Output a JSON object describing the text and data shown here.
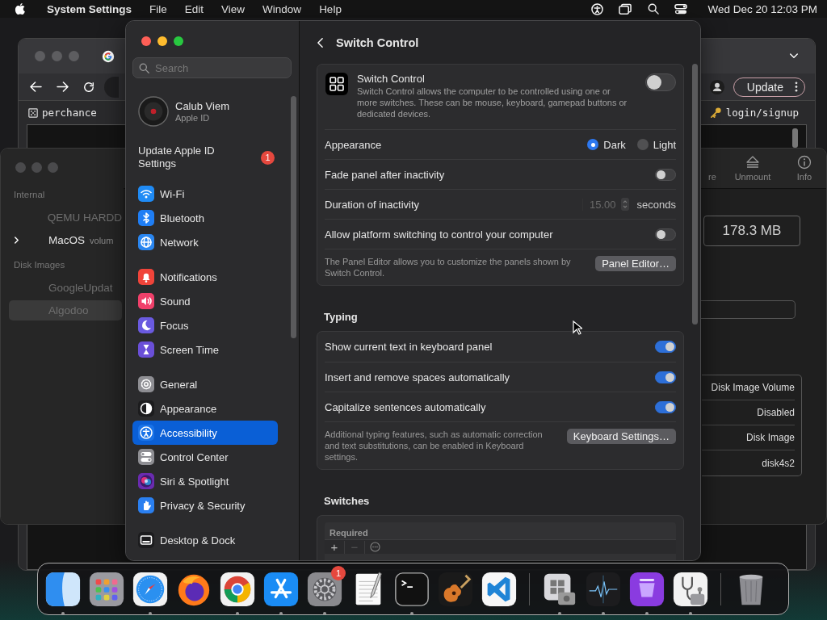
{
  "menu_bar": {
    "app_name": "System Settings",
    "menus": [
      "File",
      "Edit",
      "View",
      "Window",
      "Help"
    ],
    "clock": "Wed Dec 20  12:03 PM"
  },
  "browser": {
    "bookmark": "perchance",
    "update_button": "Update",
    "account_link": "login/signup"
  },
  "disk_utility": {
    "sidebar": [
      {
        "title": "Internal",
        "items": [
          {
            "label": "QEMU HARDD",
            "has_children": false,
            "dimmed": true,
            "selected": false
          },
          {
            "label": "MacOS",
            "detail": "volum",
            "has_children": true,
            "dimmed": false,
            "selected": false
          }
        ]
      },
      {
        "title": "Disk Images",
        "items": [
          {
            "label": "GoogleUpdat",
            "has_children": false,
            "dimmed": true,
            "selected": false
          },
          {
            "label": "Algodoo",
            "has_children": false,
            "dimmed": true,
            "selected": true
          }
        ]
      }
    ],
    "toolbar": [
      {
        "label": "re",
        "kind": "cut"
      },
      {
        "label": "Unmount",
        "kind": "eject"
      },
      {
        "label": "Info",
        "kind": "info"
      }
    ],
    "size": "178.3 MB",
    "info_values": [
      "Disk Image Volume",
      "Disabled",
      "Disk Image",
      "disk4s2"
    ]
  },
  "settings": {
    "search_placeholder": "Search",
    "account": {
      "name": "Calub Viem",
      "subtitle": "Apple ID"
    },
    "notice": {
      "label": "Update Apple ID Settings",
      "badge": "1"
    },
    "sidebar_groups": [
      [
        {
          "label": "Wi-Fi",
          "kind": "wifi",
          "selected": false
        },
        {
          "label": "Bluetooth",
          "kind": "bluetooth",
          "selected": false
        },
        {
          "label": "Network",
          "kind": "network",
          "selected": false
        }
      ],
      [
        {
          "label": "Notifications",
          "kind": "bell",
          "selected": false
        },
        {
          "label": "Sound",
          "kind": "sound",
          "selected": false
        },
        {
          "label": "Focus",
          "kind": "moon",
          "selected": false
        },
        {
          "label": "Screen Time",
          "kind": "hourglass",
          "selected": false
        }
      ],
      [
        {
          "label": "General",
          "kind": "gear",
          "selected": false
        },
        {
          "label": "Appearance",
          "kind": "appearance",
          "selected": false
        },
        {
          "label": "Accessibility",
          "kind": "accessibility",
          "selected": true
        },
        {
          "label": "Control Center",
          "kind": "toggles",
          "selected": false
        },
        {
          "label": "Siri & Spotlight",
          "kind": "orb",
          "selected": false
        },
        {
          "label": "Privacy & Security",
          "kind": "hand",
          "selected": false
        }
      ],
      [
        {
          "label": "Desktop & Dock",
          "kind": "desktop",
          "selected": false
        }
      ]
    ],
    "page": {
      "title": "Switch Control",
      "intro": {
        "title": "Switch Control",
        "description": "Switch Control allows the computer to be controlled using one or more switches. These can be mouse, keyboard, gamepad buttons or dedicated devices.",
        "on": false
      },
      "rows": [
        {
          "kind": "radio",
          "label": "Appearance",
          "options": [
            {
              "label": "Dark",
              "selected": true
            },
            {
              "label": "Light",
              "selected": false
            }
          ]
        },
        {
          "kind": "toggle",
          "label": "Fade panel after inactivity",
          "on": false
        },
        {
          "kind": "stepper",
          "label": "Duration of inactivity",
          "value": "15.00",
          "unit": "seconds",
          "disabled": true
        },
        {
          "kind": "toggle",
          "label": "Allow platform switching to control your computer",
          "on": false
        },
        {
          "kind": "note",
          "text": "The Panel Editor allows you to customize the panels shown by Switch Control.",
          "button": "Panel Editor…"
        }
      ],
      "typing": {
        "title": "Typing",
        "rows": [
          {
            "kind": "toggle",
            "label": "Show current text in keyboard panel",
            "on": true
          },
          {
            "kind": "toggle",
            "label": "Insert and remove spaces automatically",
            "on": true
          },
          {
            "kind": "toggle",
            "label": "Capitalize sentences automatically",
            "on": true
          },
          {
            "kind": "note",
            "text": "Additional typing features, such as automatic correction and text substitutions, can be enabled in Keyboard settings.",
            "button": "Keyboard Settings…"
          }
        ]
      },
      "switches": {
        "title": "Switches",
        "table_header": "Required",
        "buttons": [
          {
            "label": "+",
            "disabled": false
          },
          {
            "label": "−",
            "disabled": true
          }
        ]
      }
    }
  },
  "dock": {
    "apps": [
      {
        "kind": "finder",
        "running": true
      },
      {
        "kind": "launchpad",
        "running": false
      },
      {
        "kind": "safari",
        "running": true
      },
      {
        "kind": "firefox",
        "running": false
      },
      {
        "kind": "chrome",
        "running": true
      },
      {
        "kind": "appstore",
        "running": true
      },
      {
        "kind": "settings",
        "running": true,
        "badge": "1"
      },
      {
        "kind": "textedit",
        "running": false
      },
      {
        "kind": "terminal",
        "running": true
      },
      {
        "kind": "guitar",
        "running": false
      },
      {
        "kind": "vscode",
        "running": false
      }
    ],
    "utilities": [
      {
        "kind": "drive",
        "running": true
      },
      {
        "kind": "activity",
        "running": true
      },
      {
        "kind": "layers",
        "running": true
      },
      {
        "kind": "stethoscope",
        "running": true
      }
    ],
    "trash": {
      "running": false
    }
  }
}
